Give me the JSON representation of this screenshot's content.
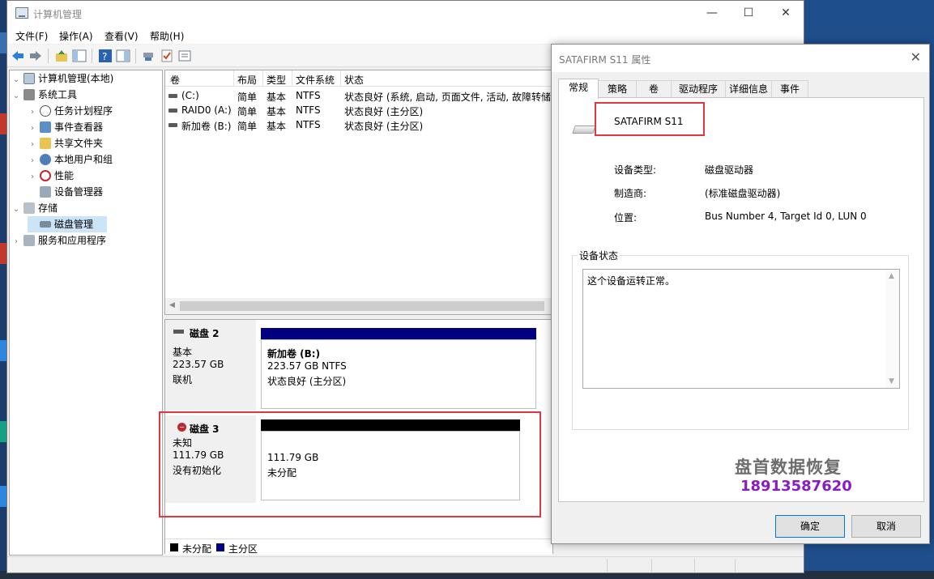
{
  "window": {
    "title": "计算机管理",
    "minimize": "—",
    "maximize": "☐",
    "close": "✕"
  },
  "menu": [
    "文件(F)",
    "操作(A)",
    "查看(V)",
    "帮助(H)"
  ],
  "tree": {
    "root": "计算机管理(本地)",
    "system_tools": "系统工具",
    "task_scheduler": "任务计划程序",
    "event_viewer": "事件查看器",
    "shared_folders": "共享文件夹",
    "local_users": "本地用户和组",
    "performance": "性能",
    "device_manager": "设备管理器",
    "storage": "存储",
    "disk_management": "磁盘管理",
    "services_apps": "服务和应用程序"
  },
  "volume_table": {
    "headers": [
      "卷",
      "布局",
      "类型",
      "文件系统",
      "状态"
    ],
    "rows": [
      [
        "(C:)",
        "简单",
        "基本",
        "NTFS",
        "状态良好 (系统, 启动, 页面文件, 活动, 故障转储,"
      ],
      [
        "RAID0 (A:)",
        "简单",
        "基本",
        "NTFS",
        "状态良好 (主分区)"
      ],
      [
        "新加卷 (B:)",
        "简单",
        "基本",
        "NTFS",
        "状态良好 (主分区)"
      ]
    ]
  },
  "disks": [
    {
      "title": "磁盘 2",
      "type": "基本",
      "size": "223.57 GB",
      "state": "联机",
      "partition": {
        "name": "新加卷  (B:)",
        "size_fs": "223.57 GB NTFS",
        "status": "状态良好 (主分区)"
      }
    },
    {
      "title": "磁盘 3",
      "type": "未知",
      "size": "111.79 GB",
      "state": "没有初始化",
      "partition": {
        "size": "111.79 GB",
        "status": "未分配"
      }
    }
  ],
  "legend": {
    "unallocated": "未分配",
    "primary": "主分区"
  },
  "dialog": {
    "title": "SATAFIRM    S11 属性",
    "close": "✕",
    "tabs": [
      "常规",
      "策略",
      "卷",
      "驱动程序",
      "详细信息",
      "事件"
    ],
    "device_name": "SATAFIRM    S11",
    "device_type_label": "设备类型:",
    "device_type_value": "磁盘驱动器",
    "manufacturer_label": "制造商:",
    "manufacturer_value": "(标准磁盘驱动器)",
    "location_label": "位置:",
    "location_value": "Bus Number 4, Target Id 0, LUN 0",
    "status_group_label": "设备状态",
    "status_text": "这个设备运转正常。",
    "watermark_name": "盘首数据恢复",
    "watermark_phone": "18913587620",
    "ok": "确定",
    "cancel": "取消"
  },
  "colors": {
    "unallocated": "#000000",
    "primary_partition": "#000080",
    "highlight": "#e0383e"
  }
}
